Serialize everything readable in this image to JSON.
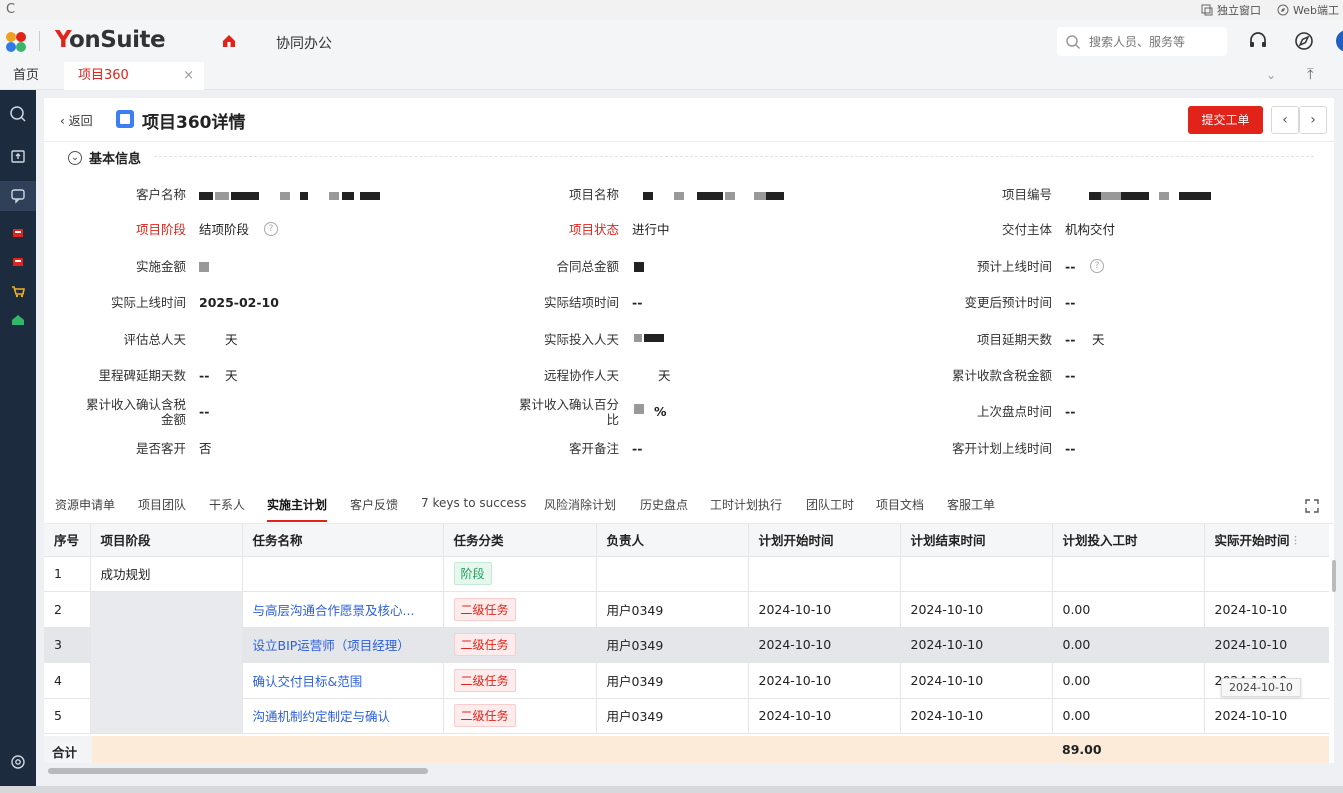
{
  "browser": {
    "reload_glyph": "C",
    "independent_window": "独立窗口",
    "web_label": "Web端工"
  },
  "header": {
    "brand_prefix": "Y",
    "brand_rest": "onSuite",
    "nav_label": "协同办公",
    "search_placeholder": "搜索人员、服务等"
  },
  "tabs": {
    "home": "首页",
    "active": "项目360",
    "close_glyph": "×"
  },
  "page": {
    "back_label": "返回",
    "title": "项目360详情",
    "submit_label": "提交工单",
    "section_title": "基本信息"
  },
  "fields": {
    "customer_name": "客户名称",
    "project_name": "项目名称",
    "project_code": "项目编号",
    "project_stage_label": "项目阶段",
    "project_stage_value": "结项阶段",
    "project_status_label": "项目状态",
    "project_status_value": "进行中",
    "delivery_entity_label": "交付主体",
    "delivery_entity_value": "机构交付",
    "impl_amount_label": "实施金额",
    "contract_amount_label": "合同总金额",
    "planned_online_label": "预计上线时间",
    "planned_online_value": "--",
    "actual_online_label": "实际上线时间",
    "actual_online_value": "2025-02-10",
    "actual_close_label": "实际结项时间",
    "actual_close_value": "--",
    "changed_planned_label": "变更后预计时间",
    "changed_planned_value": "--",
    "eval_days_label": "评估总人天",
    "eval_days_unit": "天",
    "actual_days_label": "实际投入人天",
    "delay_days_label": "项目延期天数",
    "delay_days_value": "--",
    "delay_days_unit": "天",
    "milestone_delay_label": "里程碑延期天数",
    "milestone_delay_value": "--",
    "milestone_delay_unit": "天",
    "remote_days_label": "远程协作人天",
    "remote_days_unit": "天",
    "cum_collect_label": "累计收款含税金额",
    "cum_collect_value": "--",
    "cum_income_label_1": "累计收入确认含税",
    "cum_income_label_2": "金额",
    "cum_income_value": "--",
    "cum_income_pct_label_1": "累计收入确认百分",
    "cum_income_pct_label_2": "比",
    "cum_income_pct_unit": "%",
    "last_check_label": "上次盘点时间",
    "last_check_value": "--",
    "is_kaikai_label": "是否客开",
    "is_kaikai_value": "否",
    "kaikai_note_label": "客开备注",
    "kaikai_note_value": "--",
    "kaikai_plan_label": "客开计划上线时间",
    "kaikai_plan_value": "--"
  },
  "sub_tabs": [
    "资源申请单",
    "项目团队",
    "干系人",
    "实施主计划",
    "客户反馈",
    "7 keys to success",
    "风险消除计划",
    "历史盘点",
    "工时计划执行",
    "团队工时",
    "项目文档",
    "客服工单"
  ],
  "sub_tab_active": "实施主计划",
  "table": {
    "columns": [
      "序号",
      "项目阶段",
      "任务名称",
      "任务分类",
      "负责人",
      "计划开始时间",
      "计划结束时间",
      "计划投入工时",
      "实际开始时间"
    ],
    "rows": [
      {
        "no": "1",
        "stage": "成功规划",
        "task": "",
        "category": "阶段",
        "owner": "",
        "plan_start": "",
        "plan_end": "",
        "plan_hours": "",
        "actual_start": ""
      },
      {
        "no": "2",
        "stage": "",
        "task": "与高层沟通合作愿景及核心...",
        "category": "二级任务",
        "owner": "用户0349",
        "plan_start": "2024-10-10",
        "plan_end": "2024-10-10",
        "plan_hours": "0.00",
        "actual_start": "2024-10-10"
      },
      {
        "no": "3",
        "stage": "",
        "task": "设立BIP运营师（项目经理）",
        "category": "二级任务",
        "owner": "用户0349",
        "plan_start": "2024-10-10",
        "plan_end": "2024-10-10",
        "plan_hours": "0.00",
        "actual_start": "2024-10-10"
      },
      {
        "no": "4",
        "stage": "",
        "task": "确认交付目标&范围",
        "category": "二级任务",
        "owner": "用户0349",
        "plan_start": "2024-10-10",
        "plan_end": "2024-10-10",
        "plan_hours": "0.00",
        "actual_start": "2024-10-10"
      },
      {
        "no": "5",
        "stage": "",
        "task": "沟通机制约定制定与确认",
        "category": "二级任务",
        "owner": "用户0349",
        "plan_start": "2024-10-10",
        "plan_end": "2024-10-10",
        "plan_hours": "0.00",
        "actual_start": "2024-10-10"
      }
    ],
    "tooltip": "2024-10-10",
    "sum_label": "合计",
    "sum_hours": "89.00"
  },
  "colors": {
    "brand_red": "#e2231a",
    "sidebar_bg": "#1c2b3d",
    "link_blue": "#2b5fd9",
    "sum_bg": "#fbebd8"
  }
}
